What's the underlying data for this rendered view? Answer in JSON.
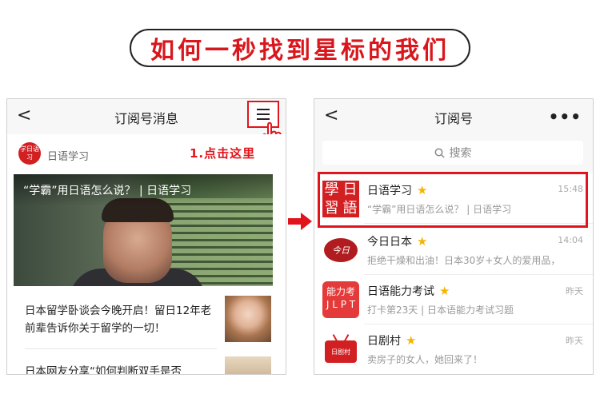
{
  "banner": {
    "title": "如何一秒找到星标的我们"
  },
  "left_phone": {
    "back_glyph": "<",
    "title": "订阅号消息",
    "menu_glyph": "☰",
    "account": {
      "avatar_text": "学日语习",
      "name": "日语学习"
    },
    "instruction": "1.点击这里",
    "hero": {
      "title": "“学霸”用日语怎么说？ | 日语学习"
    },
    "articles": [
      {
        "title": "日本留学卧谈会今晚开启！留日12年老前辈告诉你关于留学的一切！"
      },
      {
        "title": "日本网友分享“如何判断双手是否"
      }
    ]
  },
  "right_phone": {
    "back_glyph": "<",
    "title": "订阅号",
    "more_glyph": "•••",
    "search": {
      "icon": "search-icon",
      "placeholder": "搜索"
    },
    "subscriptions": [
      {
        "name": "日语学习",
        "starred": true,
        "message": "“学霸”用日语怎么说？ | 日语学习",
        "time": "15:48",
        "avatar": "學日習語",
        "highlighted": true
      },
      {
        "name": "今日日本",
        "starred": true,
        "message": "拒绝干燥和出油！日本30岁+女人的爱用品，",
        "time": "14:04",
        "avatar": "今日"
      },
      {
        "name": "日语能力考试",
        "starred": true,
        "message": "打卡第23天 | 日本语能力考试习题",
        "time": "昨天",
        "avatar": "能力考 JLPT"
      },
      {
        "name": "日剧村",
        "starred": true,
        "message": "卖房子的女人，她回来了！",
        "time": "昨天",
        "avatar": "日剧村"
      }
    ]
  },
  "colors": {
    "accent_red": "#e2141b",
    "star": "#f5b400"
  }
}
